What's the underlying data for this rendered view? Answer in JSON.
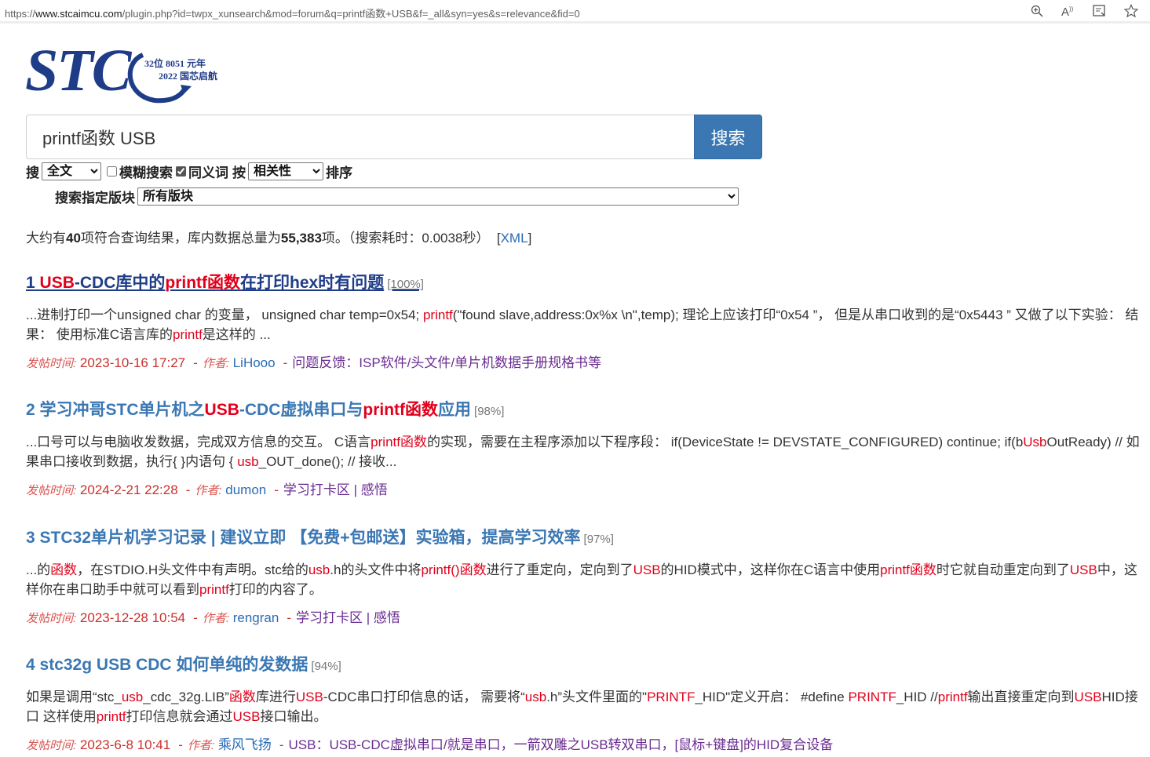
{
  "browser": {
    "url_prefix": "https://",
    "url_host": "www.stcaimcu.com",
    "url_rest": "/plugin.php?id=twpx_xunsearch&mod=forum&q=printf函数+USB&f=_all&syn=yes&s=relevance&fid=0",
    "icons": [
      "zoom-icon",
      "read-aloud-icon",
      "immersive-reader-icon",
      "favorite-star-icon"
    ]
  },
  "logo": {
    "text": "STC",
    "line1": "32位 8051 元年",
    "line2": "2022 国芯启航"
  },
  "search": {
    "query": "printf函数 USB",
    "button": "搜索",
    "prefix": "搜",
    "scope": "全文",
    "fuzzy_label": "模糊搜索",
    "fuzzy_checked": false,
    "synonym_label": "同义词",
    "synonym_checked": true,
    "sort_prefix": "按",
    "sort": "相关性",
    "sort_suffix": "排序",
    "forum_label": "搜索指定版块",
    "forum": "所有版块"
  },
  "summary": {
    "p1": "大约有",
    "count": "40",
    "p2": "项符合查询结果，库内数据总量为",
    "total": "55,383",
    "p3": "项。（搜索耗时：0.0038秒）  [",
    "xml": "XML",
    "p4": "]"
  },
  "meta_labels": {
    "time": "发帖时间:",
    "author": "作者:",
    "sep": "-"
  },
  "results": [
    {
      "num": "1",
      "t": [
        "",
        "USB",
        "-CDC库中的",
        "printf函数",
        "在打印hex时有问题"
      ],
      "pct": "[100%]",
      "s": [
        "...进制打印一个unsigned char 的变量， unsigned char temp=0x54; ",
        "printf",
        "(\"found slave,address:0x%x \\n\",temp); 理论上应该打印“0x54 ”， 但是从串口收到的是“0x5443 ” 又做了以下实验： 结果： 使用标准C语言库的",
        "printf",
        "是这样的 ..."
      ],
      "time": "2023-10-16 17:27",
      "author": "LiHooo",
      "forum": "问题反馈：ISP软件/头文件/单片机数据手册规格书等"
    },
    {
      "num": "2",
      "t": [
        "学习冲哥STC单片机之",
        "USB",
        "-CDC虚拟串口与",
        "printf函数",
        "应用"
      ],
      "pct": "[98%]",
      "s": [
        "...口号可以与电脑收发数据，完成双方信息的交互。 C语言",
        "printf函数",
        "的实现，需要在主程序添加以下程序段： if(DeviceState != DEVSTATE_CONFIGURED) continue; if(b",
        "Usb",
        "OutReady) // 如果串口接收到数据，执行{ }内语句 { ",
        "usb",
        "_OUT_done(); // 接收..."
      ],
      "time": "2024-2-21 22:28",
      "author": "dumon",
      "forum": "学习打卡区 | 感悟"
    },
    {
      "num": "3",
      "t": [
        "STC32单片机学习记录 | 建议立即 【免费+包邮送】实验箱，提高学习效率"
      ],
      "pct": "[97%]",
      "s": [
        "...的",
        "函数",
        "，在STDIO.H头文件中有声明。stc给的",
        "usb",
        ".h的头文件中将",
        "printf()",
        "",
        "函数",
        "进行了重定向，定向到了",
        "USB",
        "的HID模式中，这样你在C语言中使用",
        "printf函数",
        "时它就自动重定向到了",
        "USB",
        "中，这样你在串口助手中就可以看到",
        "printf",
        "打印的内容了。"
      ],
      "time": "2023-12-28 10:54",
      "author": "rengran",
      "forum": "学习打卡区 | 感悟"
    },
    {
      "num": "4",
      "t": [
        "stc32g USB CDC 如何单纯的发数据"
      ],
      "pct": "[94%]",
      "s": [
        "如果是调用“stc_",
        "usb",
        "_cdc_32g.LIB”",
        "函数",
        "库进行",
        "USB",
        "-CDC串口打印信息的话， 需要将“",
        "usb",
        ".h”头文件里面的\"",
        "PRINTF",
        "_HID\"定义开启： #define ",
        "PRINTF",
        "_HID //",
        "printf",
        "输出直接重定向到",
        "USB",
        "HID接口 这样使用",
        "printf",
        "打印信息就会通过",
        "USB",
        "接口输出。"
      ],
      "time": "2023-6-8 10:41",
      "author": "乘风飞扬",
      "forum": "USB：USB-CDC虚拟串口/就是串口，一箭双雕之USB转双串口，[鼠标+键盘]的HID复合设备"
    }
  ]
}
